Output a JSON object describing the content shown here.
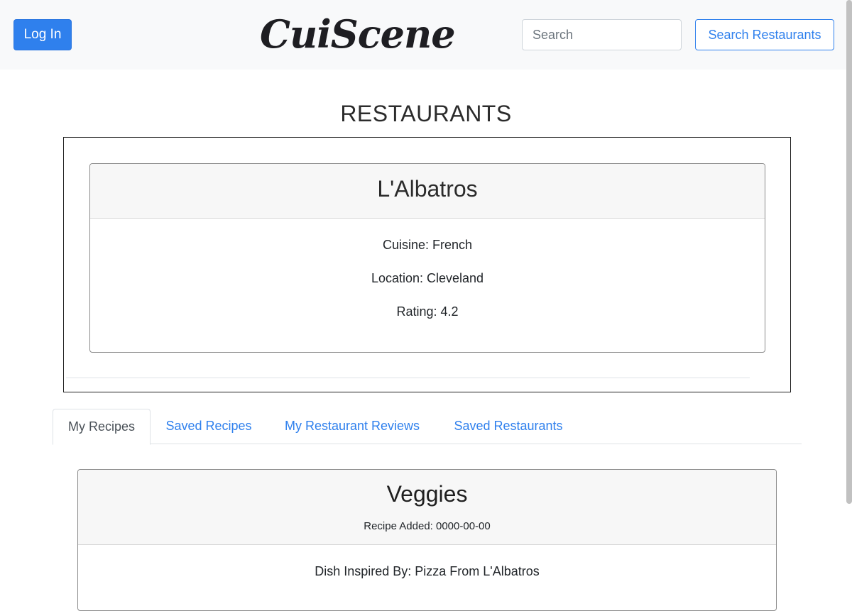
{
  "navbar": {
    "login_label": "Log In",
    "brand": "CuiScene",
    "search_placeholder": "Search",
    "search_button_label": "Search Restaurants"
  },
  "page": {
    "title": "RESTAURANTS"
  },
  "restaurant": {
    "name": "L'Albatros",
    "cuisine": "Cuisine: French",
    "location": "Location: Cleveland",
    "rating": "Rating: 4.2"
  },
  "tabs": [
    {
      "label": "My Recipes",
      "active": true
    },
    {
      "label": "Saved Recipes",
      "active": false
    },
    {
      "label": "My Restaurant Reviews",
      "active": false
    },
    {
      "label": "Saved Restaurants",
      "active": false
    }
  ],
  "recipe": {
    "title": "Veggies",
    "date": "Recipe Added: 0000-00-00",
    "inspired_by": "Dish Inspired By: Pizza From L'Albatros"
  },
  "colors": {
    "primary": "#2f80ed",
    "navbar_bg": "#f8f9fa",
    "card_header_bg": "#f7f7f7"
  }
}
